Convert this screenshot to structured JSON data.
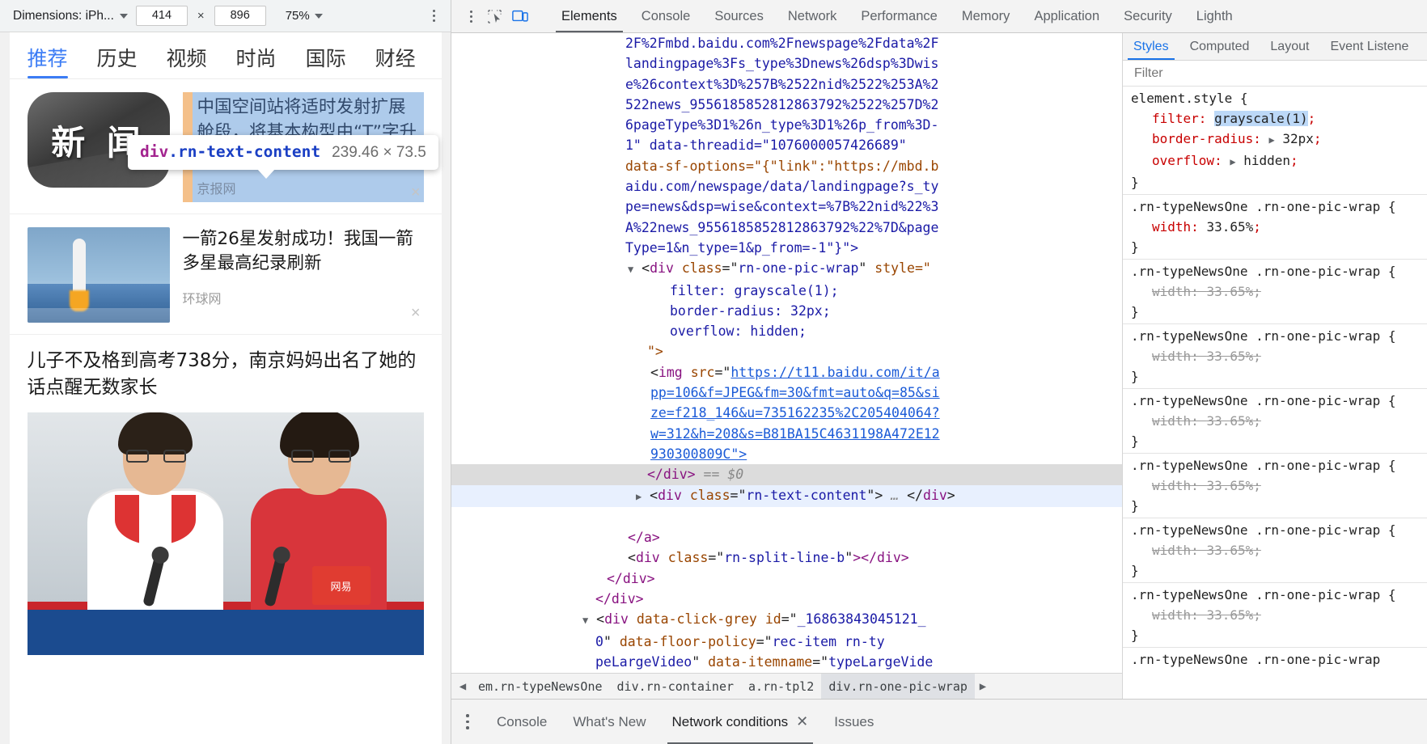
{
  "device_toolbar": {
    "dimensions_label": "Dimensions: iPh...",
    "width_value": "414",
    "multiply": "×",
    "height_value": "896",
    "zoom_value": "75%",
    "menu_icon": "more-vertical-icon"
  },
  "inspector_tooltip": {
    "tag": "div",
    "class": ".rn-text-content",
    "dimensions": "239.46 × 73.5"
  },
  "phone": {
    "tabs": [
      {
        "label": "推荐",
        "active": true
      },
      {
        "label": "历史",
        "active": false
      },
      {
        "label": "视频",
        "active": false
      },
      {
        "label": "时尚",
        "active": false
      },
      {
        "label": "国际",
        "active": false
      },
      {
        "label": "财经",
        "active": false
      }
    ],
    "items": [
      {
        "thumb_text": "新 闻",
        "title": "中国空间站将适时发射扩展舱段，将基本构型由“T”字升级…",
        "source": "京报网",
        "close": "×"
      },
      {
        "title": "一箭26星发射成功！我国一箭多星最高纪录刷新",
        "source": "环球网",
        "close": "×"
      },
      {
        "title": "儿子不及格到高考738分，南京妈妈出名了她的话点醒无数家长",
        "photo_caption": "网易"
      }
    ]
  },
  "devtools": {
    "inspect_icon": "inspect-element-icon",
    "device_toggle_icon": "device-toolbar-icon",
    "menu_icon": "more-vertical-icon",
    "tabs": [
      {
        "label": "Elements",
        "active": true
      },
      {
        "label": "Console",
        "active": false
      },
      {
        "label": "Sources",
        "active": false
      },
      {
        "label": "Network",
        "active": false
      },
      {
        "label": "Performance",
        "active": false
      },
      {
        "label": "Memory",
        "active": false
      },
      {
        "label": "Application",
        "active": false
      },
      {
        "label": "Security",
        "active": false
      },
      {
        "label": "Lighth",
        "active": false
      }
    ],
    "dom_lines": [
      {
        "id": "l1",
        "indent": 3,
        "type": "text-val",
        "text": "2F%2Fmbd.baidu.com%2Fnewspage%2Fdata%2F",
        "clipped": true
      },
      {
        "id": "l2",
        "indent": 3,
        "type": "text-val",
        "text": "landingpage%3Fs_type%3Dnews%26dsp%3Dwis"
      },
      {
        "id": "l3",
        "indent": 3,
        "type": "text-val",
        "text": "e%26context%3D%257B%2522nid%2522%253A%2"
      },
      {
        "id": "l4",
        "indent": 3,
        "type": "text-val",
        "text": "522news_9556185852812863792%2522%257D%2"
      },
      {
        "id": "l5",
        "indent": 3,
        "type": "text-val",
        "text": "6pageType%3D1%26n_type%3D1%26p_from%3D-"
      },
      {
        "id": "l6",
        "indent": 3,
        "type": "attr-line",
        "text": "1\" data-threadid=\"1076000057426689\""
      },
      {
        "id": "l7",
        "indent": 3,
        "type": "attr-line2",
        "text": "data-sf-options=\"{\"link\":\"https://mbd.b"
      },
      {
        "id": "l8",
        "indent": 3,
        "type": "text-val",
        "text": "aidu.com/newspage/data/landingpage?s_ty"
      },
      {
        "id": "l9",
        "indent": 3,
        "type": "text-val",
        "text": "pe=news&dsp=wise&context=%7B%22nid%22%3"
      },
      {
        "id": "l10",
        "indent": 3,
        "type": "text-val",
        "text": "A%22news_9556185852812863792%22%7D&page"
      },
      {
        "id": "l11",
        "indent": 3,
        "type": "text-val",
        "text": "Type=1&n_type=1&p_from=-1\"}\">"
      },
      {
        "id": "l12",
        "indent": 3,
        "type": "open-div",
        "tag": "div",
        "attr": "class",
        "val": "rn-one-pic-wrap",
        "tail": " style=\""
      },
      {
        "id": "l13",
        "indent": 5,
        "type": "css",
        "text": "filter: grayscale(1);"
      },
      {
        "id": "l14",
        "indent": 5,
        "type": "css",
        "text": "border-radius: 32px;"
      },
      {
        "id": "l15",
        "indent": 5,
        "type": "css",
        "text": "overflow: hidden;"
      },
      {
        "id": "l16",
        "indent": 3,
        "type": "plain",
        "text": "\">"
      },
      {
        "id": "l17",
        "indent": 4,
        "type": "img-open",
        "text": "<img src=\"",
        "link": "https://t11.baidu.com/it/a"
      },
      {
        "id": "l18",
        "indent": 4,
        "type": "link",
        "text": "pp=106&f=JPEG&fm=30&fmt=auto&q=85&si"
      },
      {
        "id": "l19",
        "indent": 4,
        "type": "link",
        "text": "ze=f218_146&u=735162235%2C205404064?"
      },
      {
        "id": "l20",
        "indent": 4,
        "type": "link",
        "text": "w=312&h=208&s=B81BA15C4631198A472E12"
      },
      {
        "id": "l21",
        "indent": 4,
        "type": "link-end",
        "text": "930300809C\">"
      },
      {
        "id": "l22",
        "indent": 4,
        "type": "close-sel",
        "text": "</div>",
        "suffix": " == $0"
      },
      {
        "id": "l23",
        "indent": 4,
        "type": "collapsed-div",
        "tag": "div",
        "attr": "class",
        "val": "rn-text-content"
      },
      {
        "id": "l24",
        "indent": 3,
        "type": "close",
        "text": "</a>"
      },
      {
        "id": "l25",
        "indent": 3,
        "type": "open-div2",
        "tag": "div",
        "attr": "class",
        "val": "rn-split-line-b",
        "tail": "></div>"
      },
      {
        "id": "l26",
        "indent": 2,
        "type": "close",
        "text": "</div>"
      },
      {
        "id": "l27",
        "indent": 1,
        "type": "close",
        "text": "</div>"
      },
      {
        "id": "l28",
        "indent": 1,
        "type": "open-click-grey",
        "text": "<div data-click-grey id=\"_16863843045121_"
      },
      {
        "id": "l29",
        "indent": 2,
        "type": "attr-line3",
        "text": "0\" data-floor-policy=\"rec-item rn-ty"
      },
      {
        "id": "l30",
        "indent": 2,
        "type": "attr-line4",
        "text": "peLargeVideo\" data-itemname=\"typeLargeVide"
      }
    ],
    "breadcrumbs": [
      {
        "label": "em.rn-typeNewsOne",
        "active": false
      },
      {
        "label": "div.rn-container",
        "active": false
      },
      {
        "label": "a.rn-tpl2",
        "active": false
      },
      {
        "label": "div.rn-one-pic-wrap",
        "active": true
      }
    ],
    "breadcrumb_left_icon": "chevron-left-icon",
    "breadcrumb_right_icon": "chevron-right-icon"
  },
  "styles": {
    "tabs": [
      {
        "label": "Styles",
        "active": true
      },
      {
        "label": "Computed",
        "active": false
      },
      {
        "label": "Layout",
        "active": false
      },
      {
        "label": "Event Listene",
        "active": false
      }
    ],
    "filter_placeholder": "Filter",
    "filter_value": "",
    "element_style": {
      "selector": "element.style {",
      "close": "}",
      "declarations": [
        {
          "prop": "filter",
          "value": "grayscale(1)",
          "highlighted": true,
          "expandable": false
        },
        {
          "prop": "border-radius",
          "value": "32px",
          "highlighted": false,
          "expandable": true
        },
        {
          "prop": "overflow",
          "value": "hidden",
          "highlighted": false,
          "expandable": true
        }
      ]
    },
    "rules": [
      {
        "selector": ".rn-typeNewsOne .rn-one-pic-wrap {",
        "prop": "width",
        "value": "33.65%",
        "struck": false
      },
      {
        "selector": ".rn-typeNewsOne .rn-one-pic-wrap {",
        "prop": "width",
        "value": "33.65%",
        "struck": true
      },
      {
        "selector": ".rn-typeNewsOne .rn-one-pic-wrap {",
        "prop": "width",
        "value": "33.65%",
        "struck": true
      },
      {
        "selector": ".rn-typeNewsOne .rn-one-pic-wrap {",
        "prop": "width",
        "value": "33.65%",
        "struck": true
      },
      {
        "selector": ".rn-typeNewsOne .rn-one-pic-wrap {",
        "prop": "width",
        "value": "33.65%",
        "struck": true
      },
      {
        "selector": ".rn-typeNewsOne .rn-one-pic-wrap {",
        "prop": "width",
        "value": "33.65%",
        "struck": true
      },
      {
        "selector": ".rn-typeNewsOne .rn-one-pic-wrap {",
        "prop": "width",
        "value": "33.65%",
        "struck": true
      },
      {
        "selector": ".rn-typeNewsOne .rn-one-pic-wrap",
        "prop": "",
        "value": "",
        "struck": false
      }
    ]
  },
  "drawer": {
    "menu_icon": "more-vertical-icon",
    "tabs": [
      {
        "label": "Console",
        "active": false,
        "closable": false
      },
      {
        "label": "What's New",
        "active": false,
        "closable": false
      },
      {
        "label": "Network conditions",
        "active": true,
        "closable": true
      },
      {
        "label": "Issues",
        "active": false,
        "closable": false
      }
    ],
    "close_glyph": "✕"
  },
  "colors": {
    "accent_blue": "#1a73e8",
    "highlight_content": "#aecbeb",
    "highlight_padding": "#f4c08a",
    "tag_purple": "#881280",
    "attr_orange": "#994500",
    "value_blue": "#1a1aa6"
  }
}
